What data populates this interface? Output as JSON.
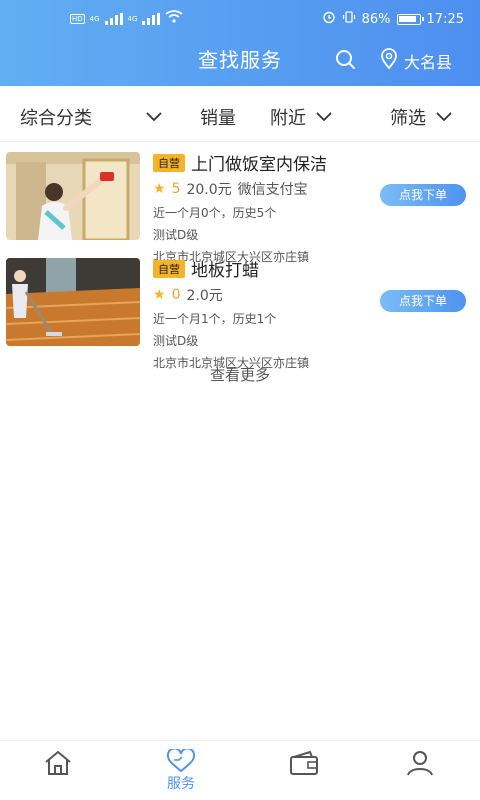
{
  "status_bar": {
    "battery": "86%",
    "time": "17:25",
    "network": "4G"
  },
  "header": {
    "title": "查找服务",
    "location": "大名县",
    "icons": [
      "search-icon",
      "location-pin-icon"
    ]
  },
  "filters": {
    "category": "综合分类",
    "sales": "销量",
    "nearby": "附近",
    "filter": "筛选"
  },
  "services": [
    {
      "tag": "自营",
      "name": "上门做饭室内保洁",
      "rating": "5",
      "price": "20.0元",
      "payment": "微信支付宝",
      "history": "近一个月0个，历史5个",
      "level": "测试D级",
      "address": "北京市北京城区大兴区亦庄镇",
      "button": "点我下单"
    },
    {
      "tag": "自营",
      "name": "地板打蜡",
      "rating": "0",
      "price": "2.0元",
      "payment": "",
      "history": "近一个月1个，历史1个",
      "level": "测试D级",
      "address": "北京市北京城区大兴区亦庄镇",
      "button": "点我下单"
    }
  ],
  "more": "查看更多",
  "tabbar": {
    "tabs": [
      {
        "label": "",
        "icon": "home-icon"
      },
      {
        "label": "服务",
        "icon": "heart-icon"
      },
      {
        "label": "",
        "icon": "wallet-icon"
      },
      {
        "label": "",
        "icon": "user-icon"
      }
    ],
    "active_color": "#4e93ef"
  },
  "colors": {
    "header_start": "#62aef2",
    "header_end": "#4d8ff0",
    "tag": "#f5b428",
    "star": "#f5b428"
  }
}
